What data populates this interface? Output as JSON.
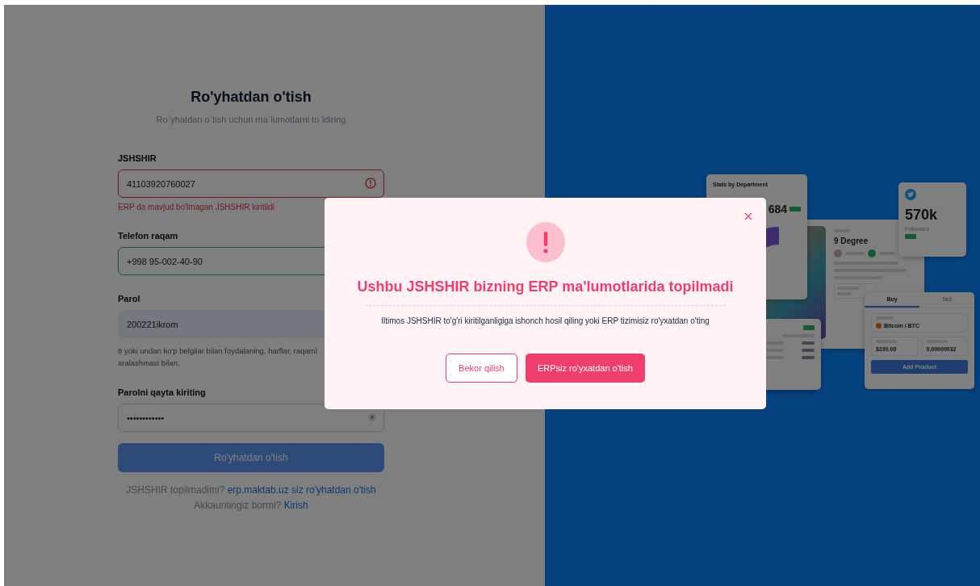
{
  "form": {
    "title": "Ro'yhatdan o'tish",
    "subtitle": "Ro`yhatdan o`tish uchun ma`lumotlarni to`ldiring",
    "fields": [
      {
        "kind": "text",
        "label": "JSHSHIR",
        "value": "41103920760027",
        "invalid": true,
        "valid": false,
        "autofilled": false,
        "error": "ERP da mavjud bo'lmagan JSHSHIR kiritildi"
      },
      {
        "kind": "text",
        "label": "Telefon raqam",
        "value": "+998 95-002-40-90",
        "invalid": false,
        "valid": true,
        "autofilled": false
      },
      {
        "kind": "text",
        "label": "Parol",
        "value": "200221ikrom",
        "invalid": false,
        "valid": false,
        "autofilled": true,
        "hint_lines": [
          "8 yoki undan ko'p belgilar bilan foydalaning, harflar, raqaml",
          "aralashmasi bilan."
        ]
      },
      {
        "kind": "masked",
        "label": "Parolni qayta kiriting",
        "value": "••••••••••••",
        "invalid": false,
        "valid": false,
        "autofilled": false
      }
    ],
    "submit": {
      "label": "Ro'yhatdan o'tish",
      "disabled": true
    },
    "footer": [
      {
        "text": "JSHSHIR topilmadimi? ",
        "link": "erp.maktab.uz siz ro'yhatdan o'tish"
      },
      {
        "text": "Akkauntingiz bormi? ",
        "link": "Kirish"
      }
    ]
  },
  "showcase": {
    "cards": [
      {
        "kind": "featured",
        "title": "9 Degree"
      },
      {
        "kind": "stats",
        "title": "Stats by Department",
        "value": "684"
      },
      {
        "kind": "earnings"
      },
      {
        "kind": "social",
        "value": "570k",
        "caption": "Followers"
      },
      {
        "kind": "trade",
        "tabs": [
          {
            "label": "Buy",
            "selected": true
          },
          {
            "label": "Sell",
            "selected": false
          }
        ],
        "coin": "Bitcoin / BTC",
        "amounts": [
          "$230.00",
          "0,00000032"
        ],
        "button": "Add Product"
      }
    ]
  },
  "modal": {
    "title": "Ushbu JSHSHIR bizning ERP ma'lumotlarida topilmadi",
    "message": "Iltimos JSHSHIR to'g'ri kiritilganligiga ishonch hosil qiling yoki ERP tizimisiz ro'yxatdan o'ting",
    "buttons": [
      {
        "label": "Bekor qilish",
        "kind": "secondary"
      },
      {
        "label": "ERPsiz ro'yxatdan o'tish",
        "kind": "primary"
      }
    ]
  }
}
